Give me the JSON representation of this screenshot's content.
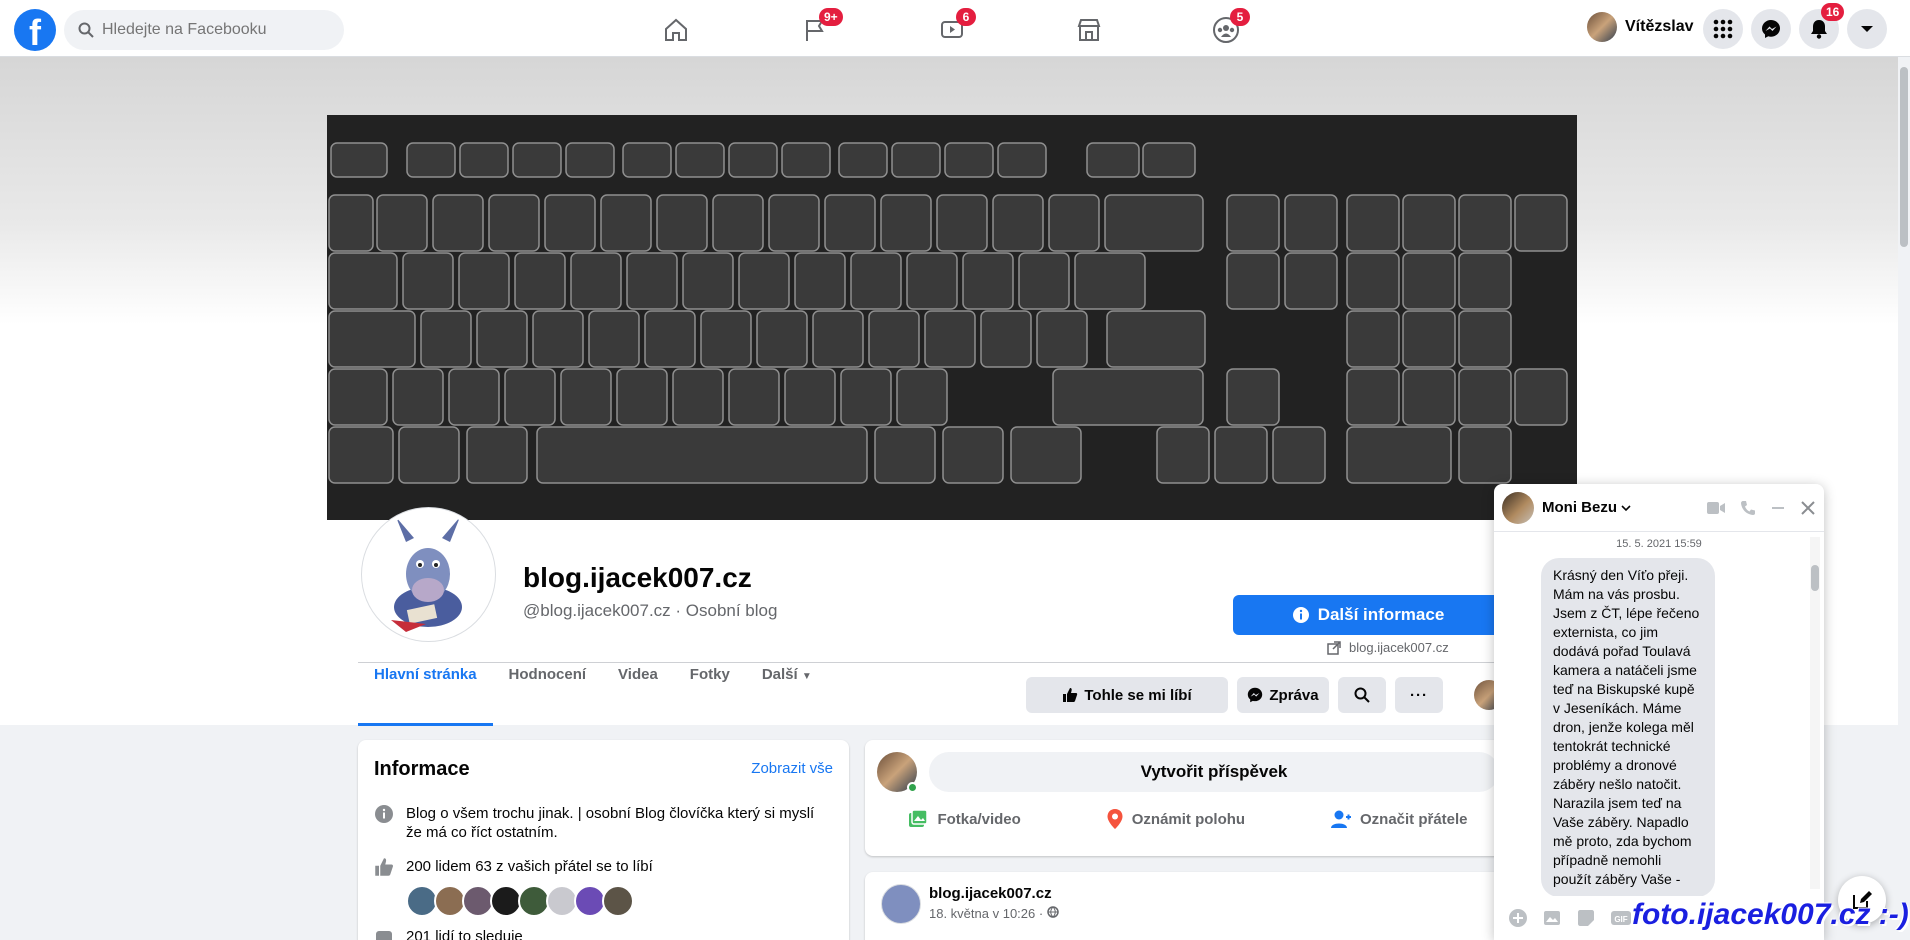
{
  "topbar": {
    "search_placeholder": "Hledejte na Facebooku",
    "badges": {
      "pages": "9+",
      "watch": "6",
      "groups": "5",
      "notifications": "16"
    },
    "user_name": "Vítězslav"
  },
  "profile": {
    "name": "blog.ijacek007.cz",
    "subtitle": "@blog.ijacek007.cz · Osobní blog",
    "info_button": "Další informace",
    "website": "blog.ijacek007.cz"
  },
  "tabs": [
    {
      "label": "Hlavní stránka"
    },
    {
      "label": "Hodnocení"
    },
    {
      "label": "Videa"
    },
    {
      "label": "Fotky"
    },
    {
      "label": "Další"
    }
  ],
  "actions": {
    "like": "Tohle se mi líbí",
    "message": "Zpráva"
  },
  "info_card": {
    "title": "Informace",
    "see_all": "Zobrazit vše",
    "description": "Blog o všem trochu jinak. | osobní Blog človíčka který si myslí že má co říct ostatním.",
    "likes": "200 lidem 63 z vašich přátel se to líbí",
    "followers": "201 lidí to sleduje"
  },
  "create_post": {
    "button": "Vytvořit příspěvek",
    "photo": "Fotka/video",
    "location": "Oznámit polohu",
    "tag": "Označit přátele"
  },
  "post": {
    "author": "blog.ijacek007.cz",
    "time": "18. května v 10:26 ·"
  },
  "chat": {
    "name": "Moni Bezu",
    "timestamp": "15. 5. 2021 15:59",
    "message": "Krásný den Víťo přeji. Mám na vás prosbu. Jsem z ČT, lépe řečeno externista, co jim dodává pořad Toulavá kamera a natáčeli jsme teď na Biskupské kupě v Jeseníkách. Máme dron, jenže kolega měl tentokrát technické problémy a dronové záběry nešlo natočit. Narazila jsem teď na Vaše záběry. Napadlo mě proto, zda bychom případně nemohli použít záběry Vaše -"
  },
  "watermark": "foto.ijacek007.cz :-)",
  "colors": {
    "brand": "#1877f2",
    "badge": "#e41e3f"
  }
}
